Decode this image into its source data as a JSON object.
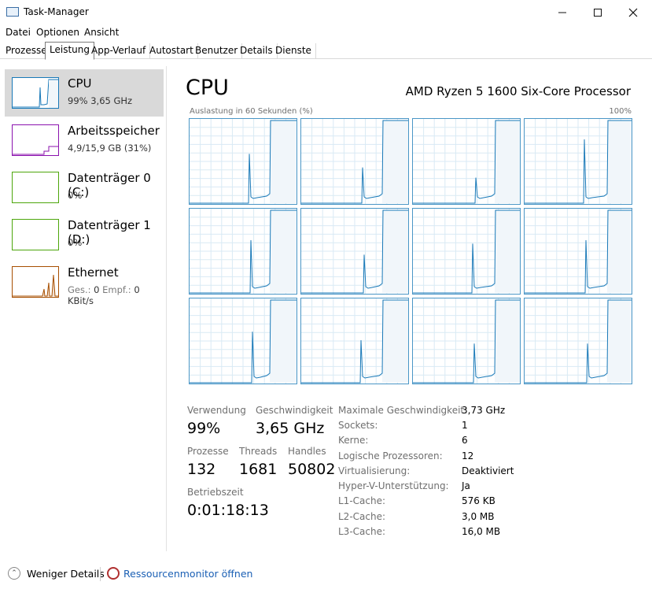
{
  "window": {
    "title": "Task-Manager"
  },
  "menu": [
    "Datei",
    "Optionen",
    "Ansicht"
  ],
  "tabs": [
    "Prozesse",
    "Leistung",
    "App-Verlauf",
    "Autostart",
    "Benutzer",
    "Details",
    "Dienste"
  ],
  "sidebar": {
    "items": [
      {
        "title": "CPU",
        "detail": "99% 3,65 GHz",
        "color": "#1979b8"
      },
      {
        "title": "Arbeitsspeicher",
        "detail": "4,9/15,9 GB (31%)",
        "color": "#8b12ae"
      },
      {
        "title": "Datenträger 0 (C:)",
        "detail": "0%",
        "color": "#4da60c"
      },
      {
        "title": "Datenträger 1 (D:)",
        "detail": "0%",
        "color": "#4da60c"
      },
      {
        "title": "Ethernet",
        "detail_parts": [
          "Ges.:",
          "0",
          "Empf.:",
          "0 KBit/s"
        ],
        "color": "#a74f01"
      }
    ]
  },
  "main": {
    "title": "CPU",
    "processor": "AMD Ryzen 5 1600 Six-Core Processor",
    "graph_caption": "Auslastung in 60 Sekunden (%)",
    "graph_max": "100%",
    "core_count": 12
  },
  "stats": {
    "usage_label": "Verwendung",
    "usage": "99%",
    "speed_label": "Geschwindigkeit",
    "speed": "3,65 GHz",
    "processes_label": "Prozesse",
    "processes": "132",
    "threads_label": "Threads",
    "threads": "1681",
    "handles_label": "Handles",
    "handles": "50802",
    "uptime_label": "Betriebszeit",
    "uptime": "0:01:18:13"
  },
  "specs": [
    {
      "key": "Maximale Geschwindigkeit:",
      "value": "3,73 GHz"
    },
    {
      "key": "Sockets:",
      "value": "1"
    },
    {
      "key": "Kerne:",
      "value": "6"
    },
    {
      "key": "Logische Prozessoren:",
      "value": "12"
    },
    {
      "key": "Virtualisierung:",
      "value": "Deaktiviert"
    },
    {
      "key": "Hyper-V-Unterstützung:",
      "value": "Ja"
    },
    {
      "key": "L1-Cache:",
      "value": "576 KB"
    },
    {
      "key": "L2-Cache:",
      "value": "3,0 MB"
    },
    {
      "key": "L3-Cache:",
      "value": "16,0 MB"
    }
  ],
  "footer": {
    "fewer_details": "Weniger Details",
    "resource_monitor": "Ressourcenmonitor öffnen"
  },
  "colors": {
    "cpu_line": "#1979b8",
    "cpu_fill": "#f1f6fa",
    "grid": "#d9eaf4"
  }
}
